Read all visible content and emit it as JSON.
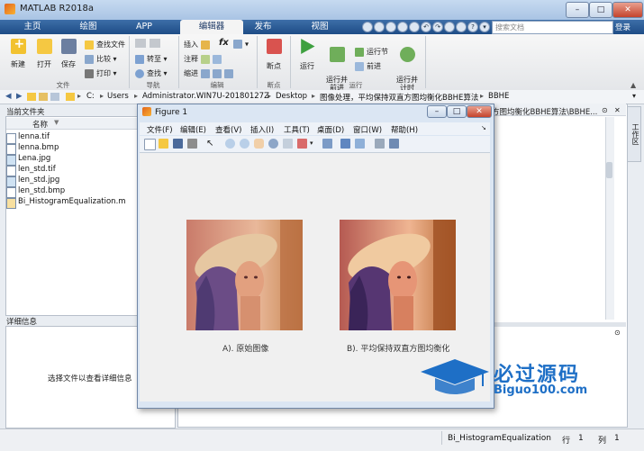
{
  "window": {
    "title": "MATLAB R2018a"
  },
  "tabs": [
    "主页",
    "绘图",
    "APP",
    "编辑器",
    "发布",
    "视图"
  ],
  "active_tab": "编辑器",
  "search": {
    "placeholder": "搜索文档"
  },
  "login": "登录",
  "ribbon": {
    "file": {
      "new": "新建",
      "open": "打开",
      "save": "保存",
      "find_files": "查找文件",
      "compare": "比较",
      "print": "打印",
      "group": "文件"
    },
    "nav": {
      "goto": "转至",
      "find": "查找",
      "group": "导航"
    },
    "edit": {
      "insert": "插入",
      "comment": "注释",
      "indent": "缩进",
      "group": "编辑",
      "fx": "fx"
    },
    "breakpoints": {
      "label": "断点",
      "group": "断点"
    },
    "run": {
      "run": "运行",
      "run_advance": "运行并\n前进",
      "run_section": "运行节",
      "advance": "前进",
      "run_time": "运行并\n计时",
      "group": "运行"
    }
  },
  "address": [
    "C:",
    "Users",
    "Administrator.WIN7U-20180127Z",
    "Desktop",
    "图像处理，平均保持双直方图均衡化BBHE算法",
    "BBHE"
  ],
  "left": {
    "current_folder": "当前文件夹",
    "name_header": "名称",
    "files": [
      "lenna.tif",
      "lenna.bmp",
      "Lena.jpg",
      "len_std.tif",
      "len_std.jpg",
      "len_std.bmp",
      "Bi_HistogramEqualization.m"
    ],
    "details_label": "详细信息",
    "details_msg": "选择文件以查看详细信息"
  },
  "right_path": "方图均衡化BBHE算法\\BBHE...",
  "workspace_tab": "工作区",
  "figure": {
    "title": "Figure 1",
    "menus": [
      "文件(F)",
      "编辑(E)",
      "查看(V)",
      "插入(I)",
      "工具(T)",
      "桌面(D)",
      "窗口(W)",
      "帮助(H)"
    ],
    "captions": [
      "A). 原始图像",
      "B). 平均保持双直方图均衡化"
    ]
  },
  "status": {
    "script": "Bi_HistogramEqualization",
    "row_label": "行",
    "row": "1",
    "col_label": "列",
    "col": "1"
  },
  "watermark": {
    "title": "必过源码",
    "url": "Biguo100.com"
  }
}
